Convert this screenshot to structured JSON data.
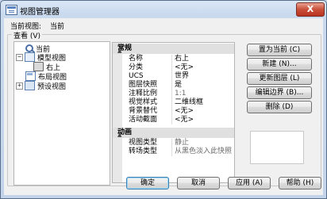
{
  "window": {
    "title": "视图管理器",
    "close_label": "X"
  },
  "current_view": {
    "label": "当前视图:",
    "value": "当前"
  },
  "group_label": "查看 (V)",
  "tree": [
    {
      "label": "当前",
      "icon": "magnifier-icon",
      "expander": ""
    },
    {
      "label": "模型视图",
      "icon": "model-view-icon",
      "expander": "−"
    },
    {
      "label": "右上",
      "icon": "camera-view-icon",
      "expander": ""
    },
    {
      "label": "布局视图",
      "icon": "layout-view-icon",
      "expander": ""
    },
    {
      "label": "预设视图",
      "icon": "preset-view-icon",
      "expander": "+"
    }
  ],
  "properties": {
    "general_header": "常规",
    "general": [
      {
        "key": "名称",
        "value": "右上",
        "greyed": false
      },
      {
        "key": "分类",
        "value": "<无>",
        "greyed": false
      },
      {
        "key": "UCS",
        "value": "世界",
        "greyed": false
      },
      {
        "key": "图层快照",
        "value": "是",
        "greyed": false
      },
      {
        "key": "注释比例",
        "value": "1:1",
        "greyed": true
      },
      {
        "key": "视觉样式",
        "value": "二维线框",
        "greyed": false
      },
      {
        "key": "背景替代",
        "value": "<无>",
        "greyed": false
      },
      {
        "key": "活动截面",
        "value": "<无>",
        "greyed": false
      }
    ],
    "animation_header": "动画",
    "animation": [
      {
        "key": "视图类型",
        "value": "静止",
        "greyed": true
      },
      {
        "key": "转场类型",
        "value": "从黑色淡入此快照",
        "greyed": true
      }
    ]
  },
  "buttons": {
    "set_current": "置为当前 (C)",
    "new": "新建 (N)...",
    "update_layers": "更新图层 (L)",
    "edit_boundaries": "编辑边界 (B)...",
    "delete": "删除 (D)"
  },
  "footer": {
    "ok": "确定",
    "cancel": "取消",
    "apply": "应用 (A)",
    "help": "帮助 (H)"
  }
}
